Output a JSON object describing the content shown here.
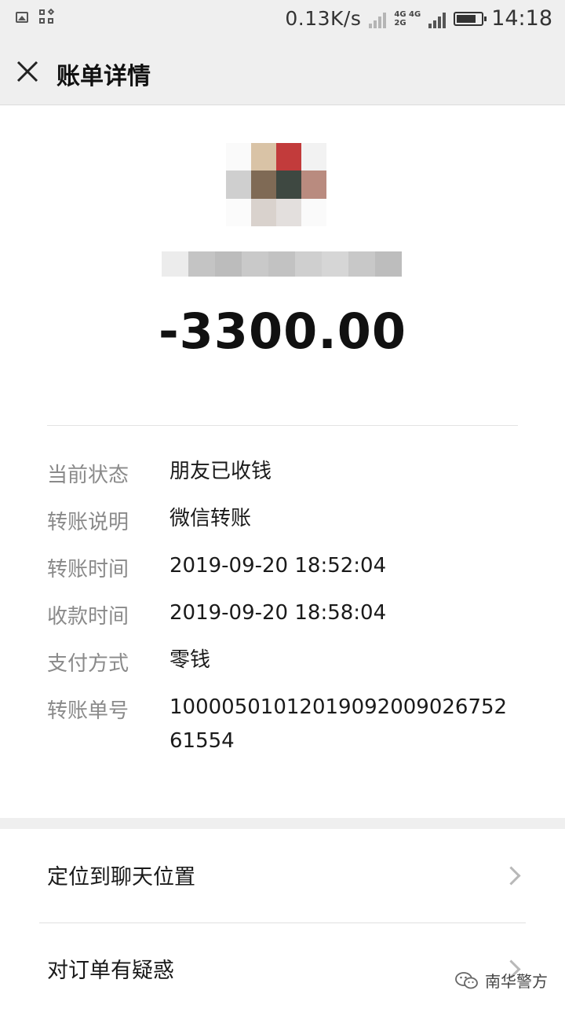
{
  "status_bar": {
    "net_speed": "0.13K/s",
    "net_labels": [
      "4G 4G",
      "2G"
    ],
    "time": "14:18"
  },
  "nav": {
    "title": "账单详情"
  },
  "transaction": {
    "amount": "-3300.00"
  },
  "details": [
    {
      "label": "当前状态",
      "value": "朋友已收钱"
    },
    {
      "label": "转账说明",
      "value": "微信转账"
    },
    {
      "label": "转账时间",
      "value": "2019-09-20 18:52:04"
    },
    {
      "label": "收款时间",
      "value": "2019-09-20 18:58:04"
    },
    {
      "label": "支付方式",
      "value": "零钱"
    },
    {
      "label": "转账单号",
      "value": "1000050101201909200902675261554"
    }
  ],
  "actions": [
    {
      "label": "定位到聊天位置"
    },
    {
      "label": "对订单有疑惑"
    }
  ],
  "watermark": {
    "text": "南华警方"
  }
}
